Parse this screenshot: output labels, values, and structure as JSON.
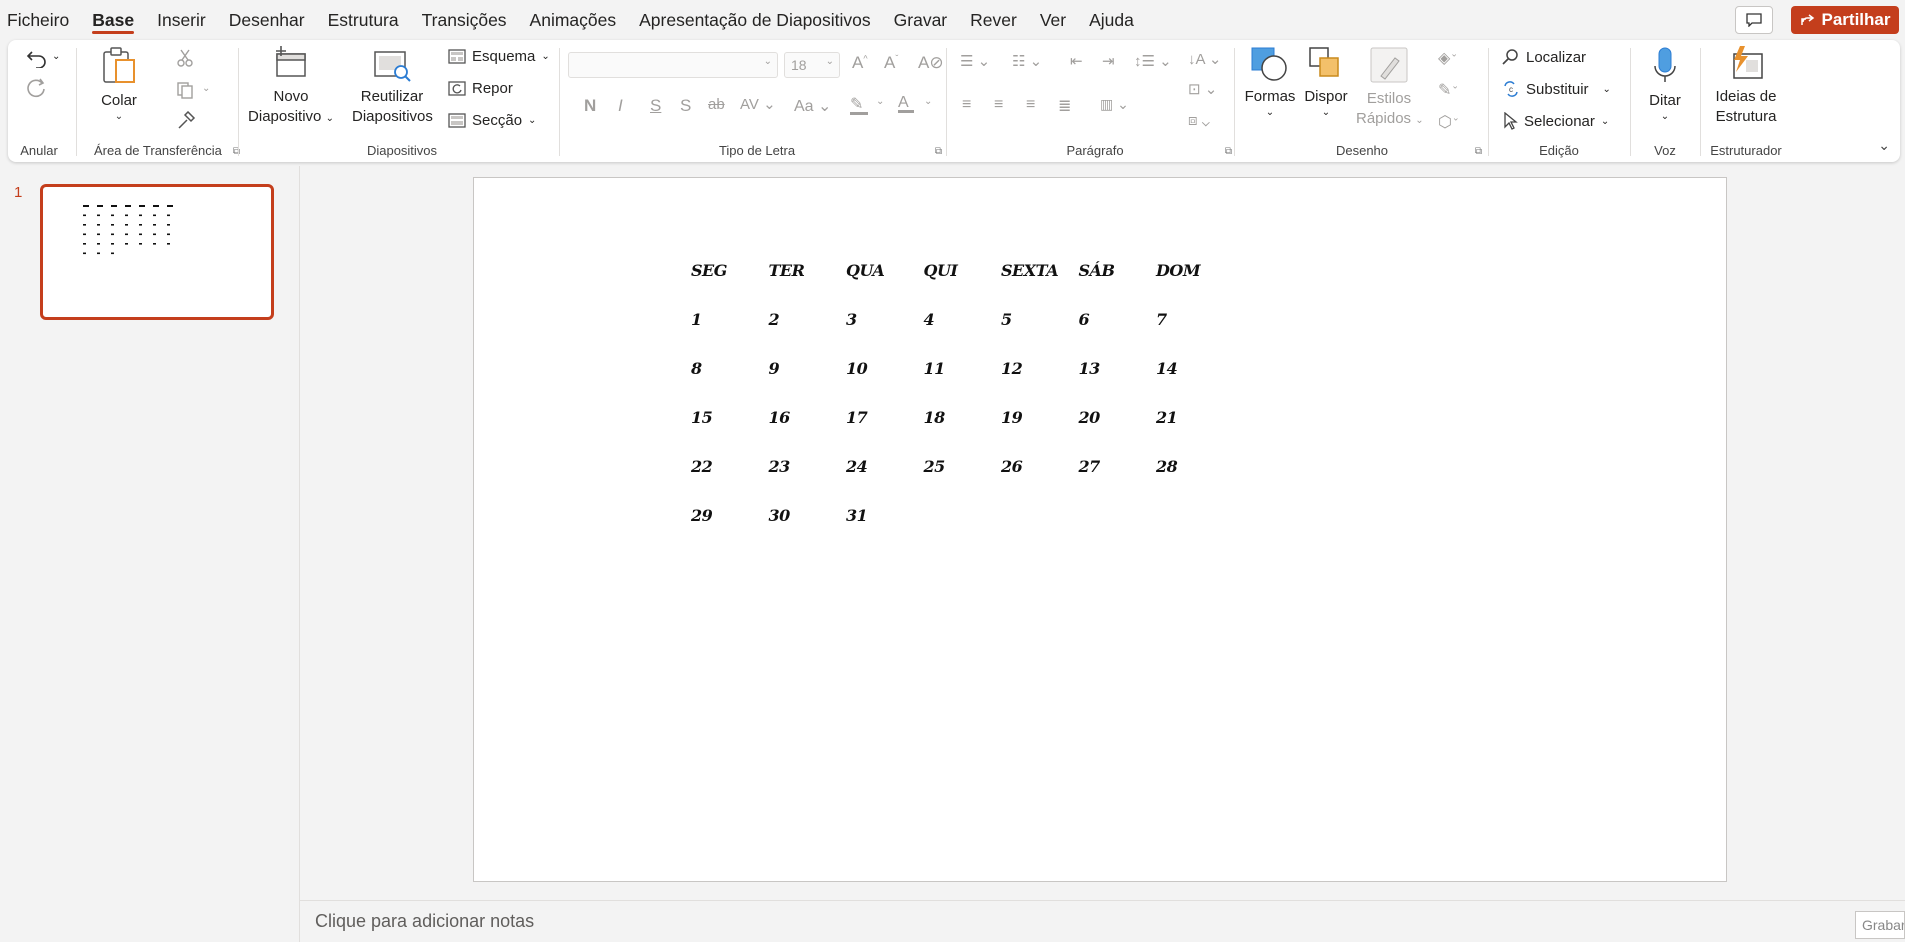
{
  "menu": {
    "tabs": [
      "Ficheiro",
      "Base",
      "Inserir",
      "Desenhar",
      "Estrutura",
      "Transições",
      "Animações",
      "Apresentação de Diapositivos",
      "Gravar",
      "Rever",
      "Ver",
      "Ajuda"
    ],
    "active_tab": "Base",
    "share_label": "Partilhar"
  },
  "ribbon": {
    "undo": {
      "label": "Anular"
    },
    "clipboard": {
      "label": "Área de Transferência",
      "paste": "Colar"
    },
    "slides": {
      "label": "Diapositivos",
      "new_slide_1": "Novo",
      "new_slide_2": "Diapositivo",
      "reuse_1": "Reutilizar",
      "reuse_2": "Diapositivos",
      "layout": "Esquema",
      "reset": "Repor",
      "section": "Secção"
    },
    "font": {
      "label": "Tipo de Letra",
      "font_size": "18",
      "font_name": ""
    },
    "paragraph": {
      "label": "Parágrafo"
    },
    "drawing": {
      "label": "Desenho",
      "shapes": "Formas",
      "arrange": "Dispor",
      "quick_styles_1": "Estilos",
      "quick_styles_2": "Rápidos"
    },
    "editing": {
      "label": "Edição",
      "find": "Localizar",
      "replace": "Substituir",
      "select": "Selecionar"
    },
    "voice": {
      "label": "Voz",
      "dictate": "Ditar"
    },
    "designer": {
      "label": "Estruturador",
      "ideas_1": "Ideias de",
      "ideas_2": "Estrutura"
    }
  },
  "thumbnails": {
    "slide_number": "1"
  },
  "slide": {
    "calendar": {
      "headers": [
        "SEG",
        "TER",
        "QUA",
        "QUI",
        "SEXTA",
        "SÁB",
        "DOM"
      ],
      "rows": [
        [
          "1",
          "2",
          "3",
          "4",
          "5",
          "6",
          "7"
        ],
        [
          "8",
          "9",
          "10",
          "11",
          "12",
          "13",
          "14"
        ],
        [
          "15",
          "16",
          "17",
          "18",
          "19",
          "20",
          "21"
        ],
        [
          "22",
          "23",
          "24",
          "25",
          "26",
          "27",
          "28"
        ],
        [
          "29",
          "30",
          "31",
          "",
          "",
          "",
          ""
        ]
      ]
    }
  },
  "notes": {
    "placeholder": "Clique para adicionar notas",
    "record_label": "Grabar"
  },
  "colors": {
    "accent": "#c43e1c"
  }
}
